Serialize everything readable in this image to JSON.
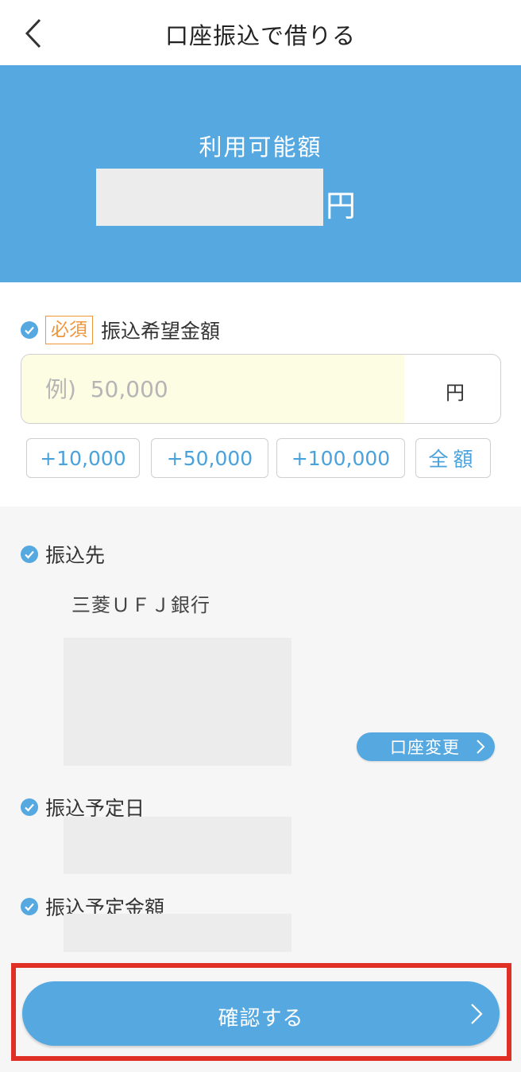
{
  "header": {
    "title": "口座振込で借りる",
    "back_icon": "chevron-left-icon"
  },
  "banner": {
    "label": "利用可能額",
    "amount": "",
    "unit": "円",
    "background": "#55a8e0"
  },
  "amount_field": {
    "required_badge": "必須",
    "label": "振込希望金額",
    "placeholder": "例)  50,000",
    "value": "",
    "unit": "円",
    "quick_buttons": [
      "+10,000",
      "+50,000",
      "+100,000",
      "全額"
    ]
  },
  "details": {
    "destination_label": "振込先",
    "bank_name": "三菱ＵＦＪ銀行",
    "change_button": "口座変更",
    "date_label": "振込予定日",
    "amount_label": "振込予定金額"
  },
  "confirm": {
    "label": "確認する"
  },
  "colors": {
    "accent": "#55a8e0",
    "required": "#f0963a",
    "highlight": "#e02f24",
    "input_bg": "#fdfde3"
  }
}
